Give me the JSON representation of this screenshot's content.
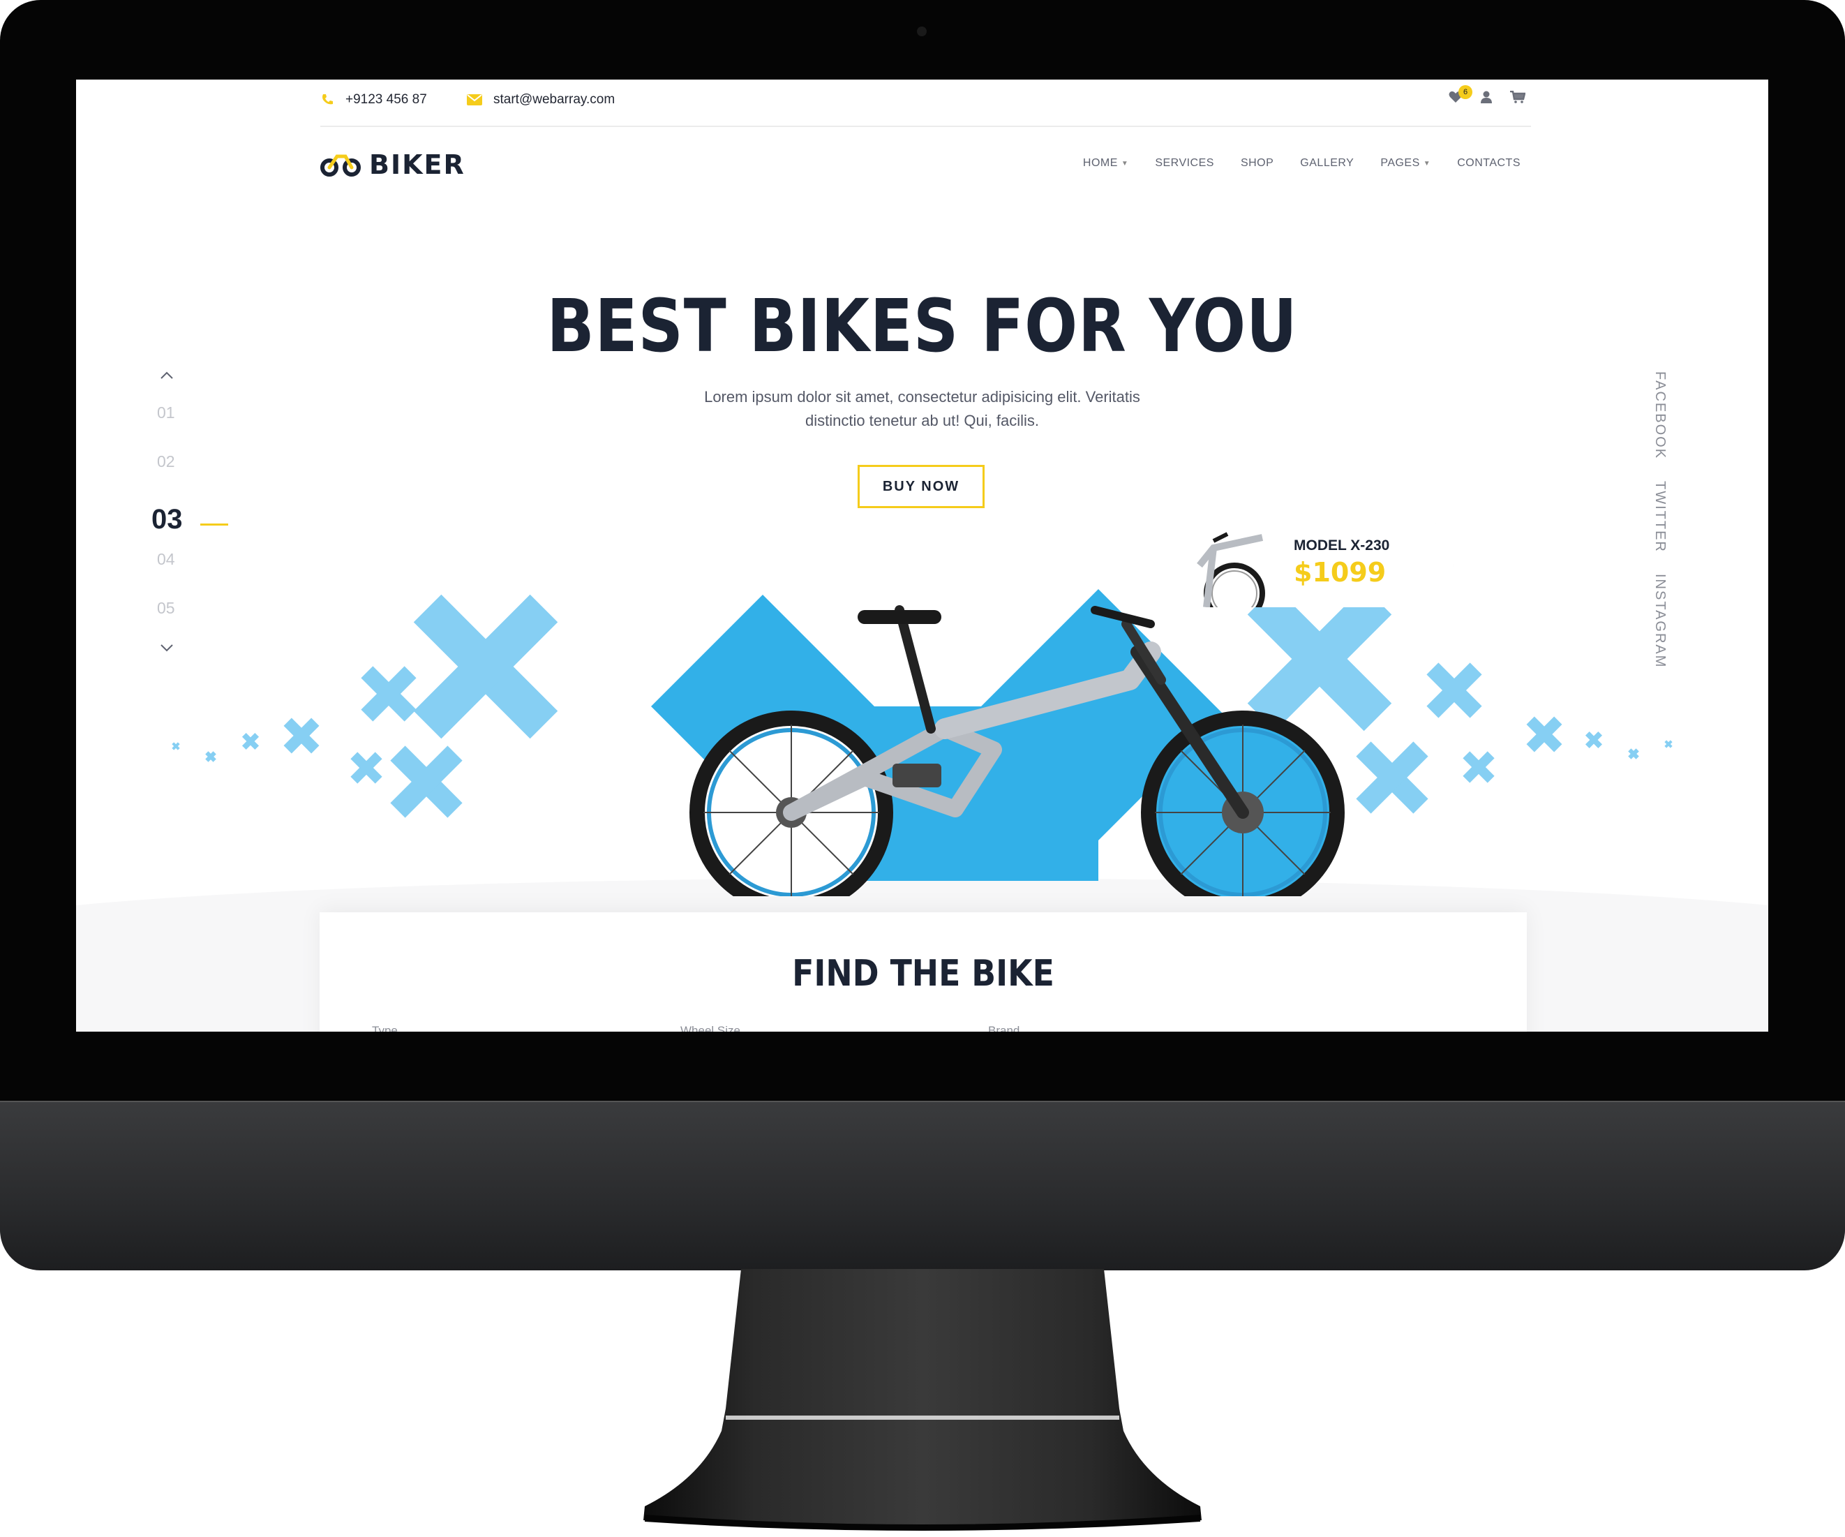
{
  "topbar": {
    "phone": "+9123 456 87",
    "email": "start@webarray.com",
    "wishlist_count": "6"
  },
  "brand": {
    "name": "BIKER"
  },
  "nav": {
    "items": [
      {
        "label": "HOME",
        "dropdown": true
      },
      {
        "label": "SERVICES",
        "dropdown": false
      },
      {
        "label": "SHOP",
        "dropdown": false
      },
      {
        "label": "GALLERY",
        "dropdown": false
      },
      {
        "label": "PAGES",
        "dropdown": true
      },
      {
        "label": "CONTACTS",
        "dropdown": false
      }
    ]
  },
  "hero": {
    "title": "BEST BIKES FOR YOU",
    "text": "Lorem ipsum dolor sit amet, consectetur adipisicing elit. Veritatis distinctio tenetur ab ut! Qui, facilis.",
    "button": "BUY NOW"
  },
  "slider": {
    "slides": [
      "01",
      "02",
      "03",
      "04",
      "05"
    ],
    "active": "03"
  },
  "social": [
    "FACEBOOK",
    "TWITTER",
    "INSTAGRAM"
  ],
  "model_card": {
    "name": "MODEL X-230",
    "price": "$1099"
  },
  "find": {
    "title": "FIND THE BIKE",
    "fields": [
      "Type",
      "Wheel Size",
      "Brand"
    ]
  },
  "colors": {
    "accent_yellow": "#f5cc1b",
    "dark_navy": "#1b2333",
    "sky_blue": "#32b0e8",
    "light_blue": "#86cff3"
  }
}
